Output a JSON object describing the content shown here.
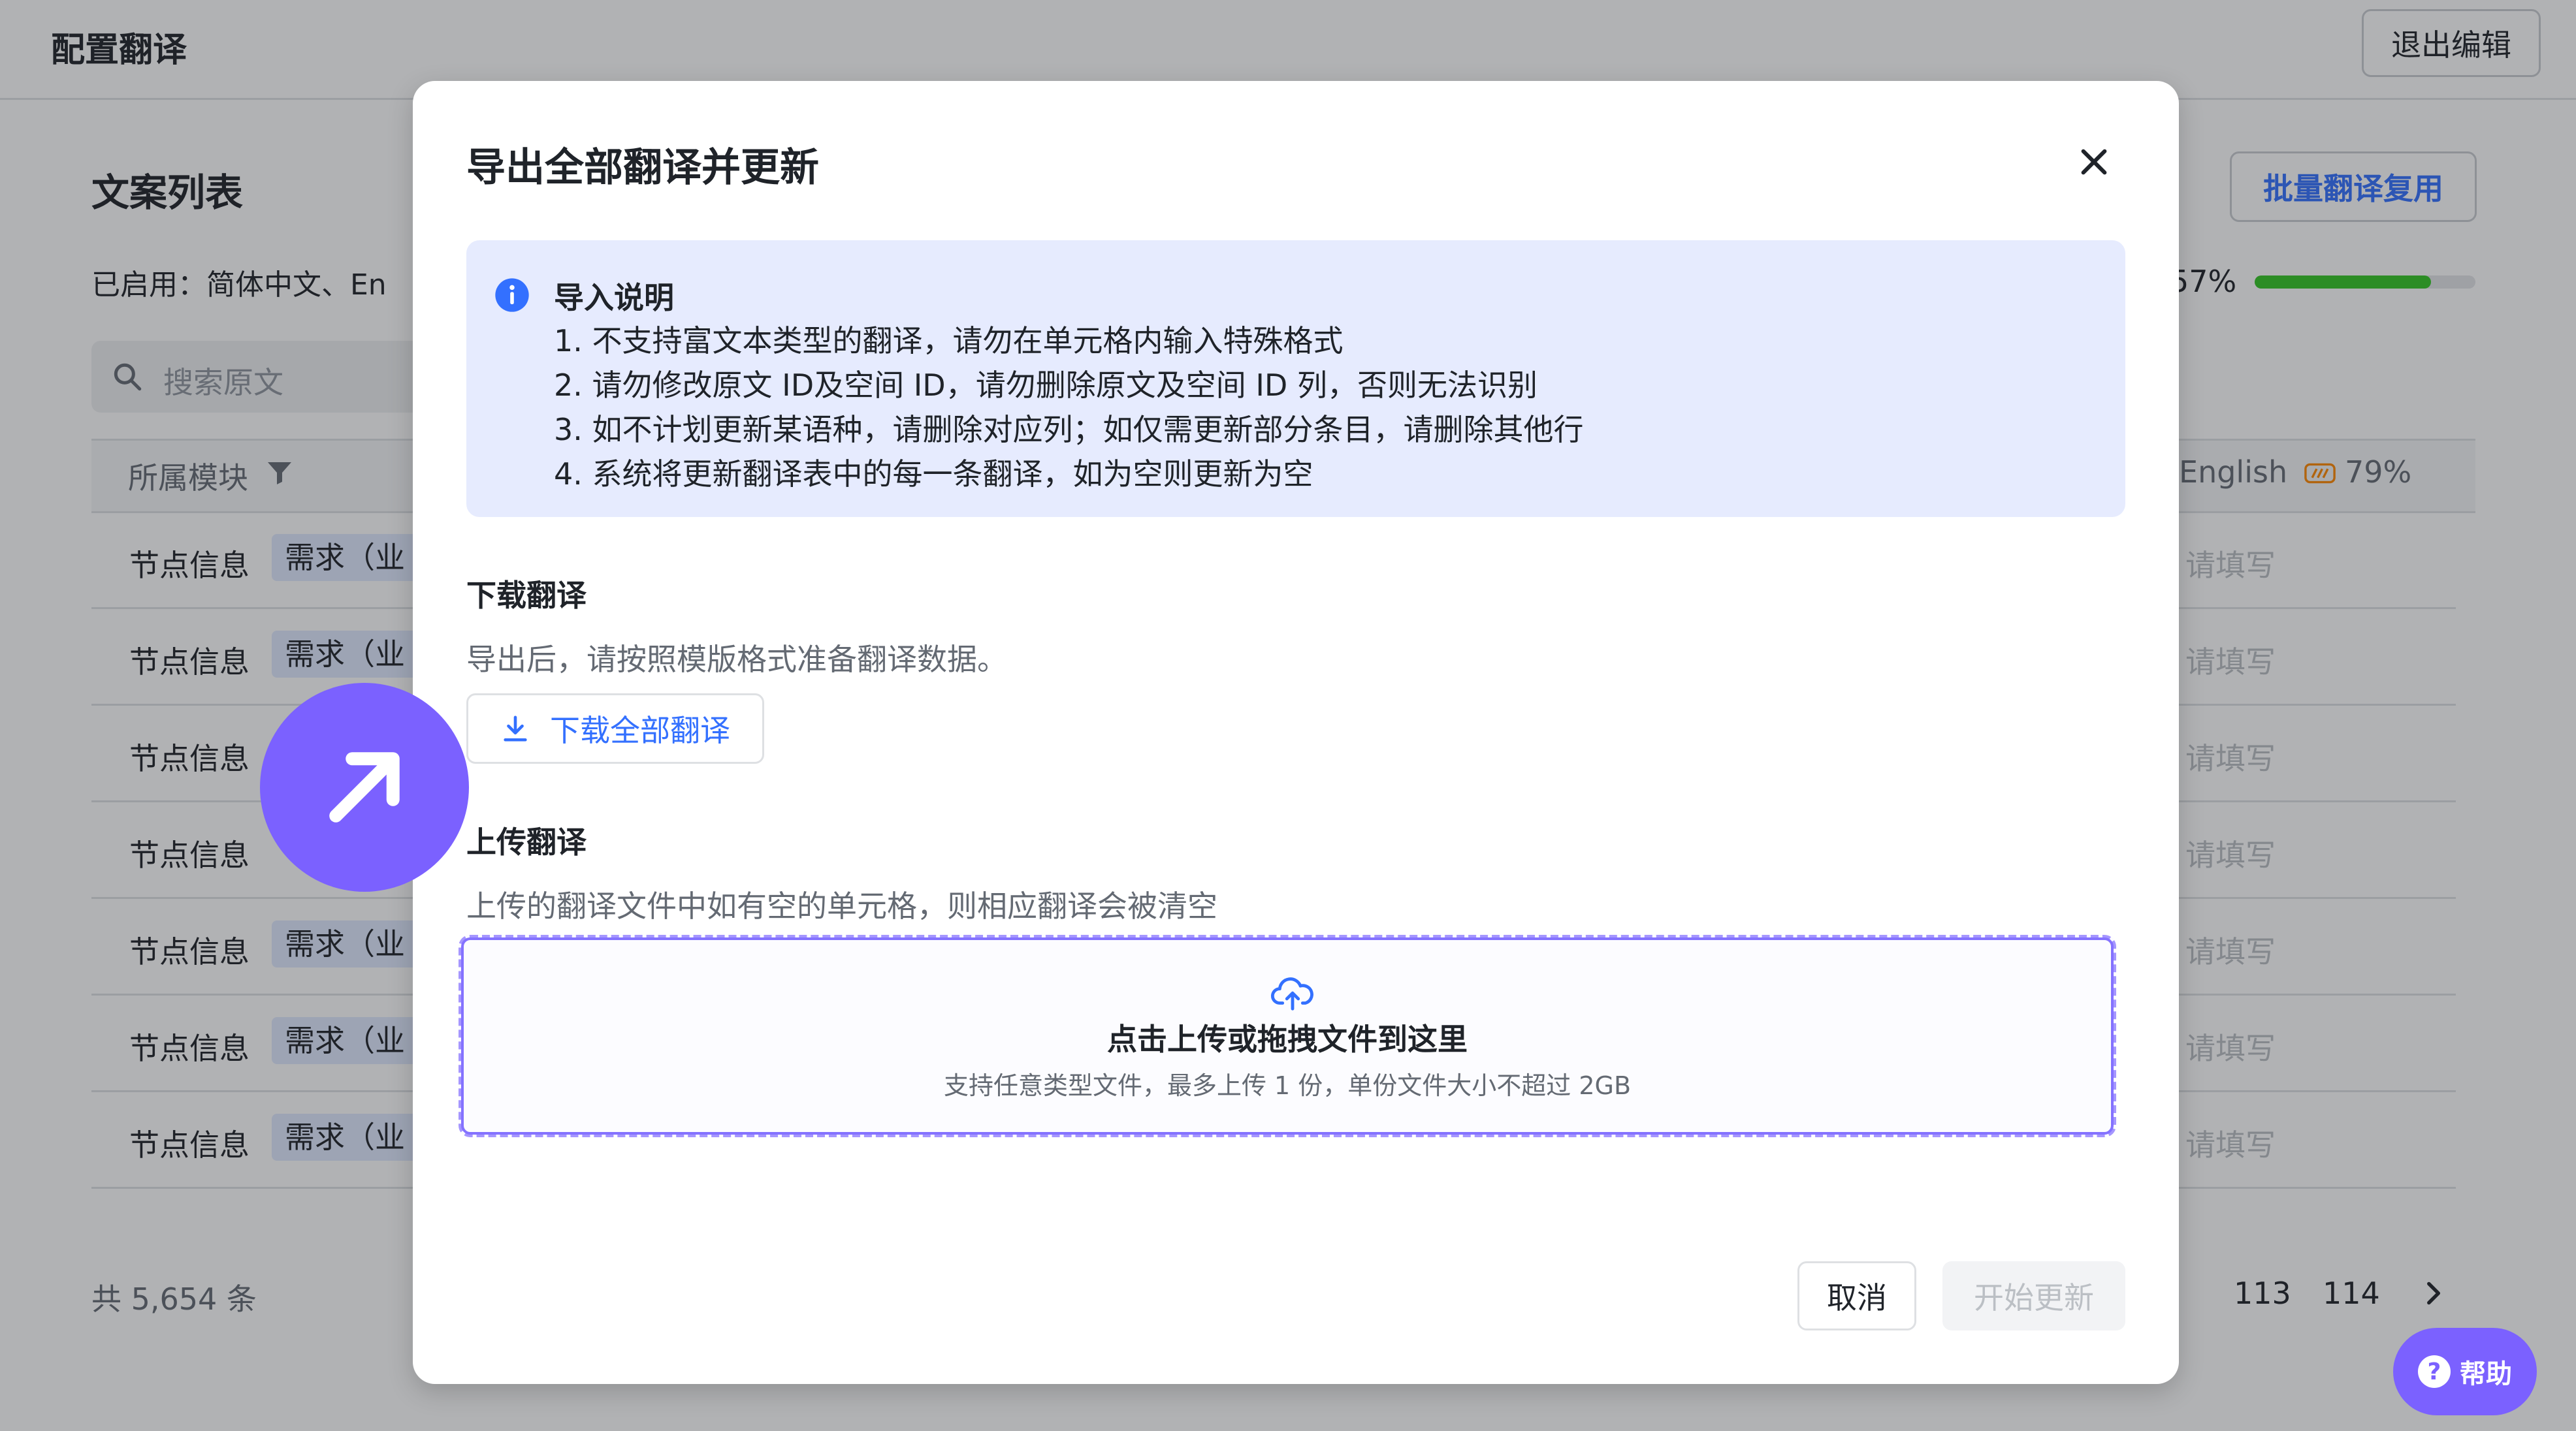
{
  "app": {
    "title": "配置翻译",
    "exit_label": "退出编辑"
  },
  "list": {
    "title": "文案列表",
    "enabled_langs": "已启用：简体中文、En",
    "search_placeholder": "搜索原文",
    "batch_label": "批量翻译复用",
    "progress_text": "57%",
    "progress_fraction": 0.8,
    "col_module": "所属模块",
    "col_en": "English",
    "col_en_pct": "79%",
    "rows": [
      {
        "module": "节点信息",
        "tag": "需求（业",
        "fill": "请填写"
      },
      {
        "module": "节点信息",
        "tag": "需求（业",
        "fill": "请填写"
      },
      {
        "module": "节点信息",
        "tag": "",
        "fill": "请填写"
      },
      {
        "module": "节点信息",
        "tag": "",
        "fill": "请填写"
      },
      {
        "module": "节点信息",
        "tag": "需求（业",
        "fill": "请填写"
      },
      {
        "module": "节点信息",
        "tag": "需求（业",
        "fill": "请填写"
      },
      {
        "module": "节点信息",
        "tag": "需求（业",
        "fill": "请填写"
      }
    ],
    "total": "共 5,654 条",
    "pages": [
      "113",
      "114"
    ],
    "help_label": "帮助",
    "help_glyph": "?"
  },
  "modal": {
    "title": "导出全部翻译并更新",
    "notice": {
      "title": "导入说明",
      "lines": [
        "1. 不支持富文本类型的翻译，请勿在单元格内输入特殊格式",
        "2. 请勿修改原文 ID及空间 ID，请勿删除原文及空间 ID 列，否则无法识别",
        "3. 如不计划更新某语种，请删除对应列；如仅需更新部分条目，请删除其他行",
        "4. 系统将更新翻译表中的每一条翻译，如为空则更新为空"
      ]
    },
    "download": {
      "title": "下载翻译",
      "desc": "导出后，请按照模版格式准备翻译数据。",
      "button": "下载全部翻译"
    },
    "upload": {
      "title": "上传翻译",
      "desc": "上传的翻译文件中如有空的单元格，则相应翻译会被清空",
      "zone_title": "点击上传或拖拽文件到这里",
      "zone_sub": "支持任意类型文件，最多上传 1 份，单份文件大小不超过 2GB"
    },
    "cancel_label": "取消",
    "start_label": "开始更新"
  },
  "colors": {
    "accent": "#3370ff",
    "cursor": "#7b61ff",
    "progress": "#34c724"
  }
}
